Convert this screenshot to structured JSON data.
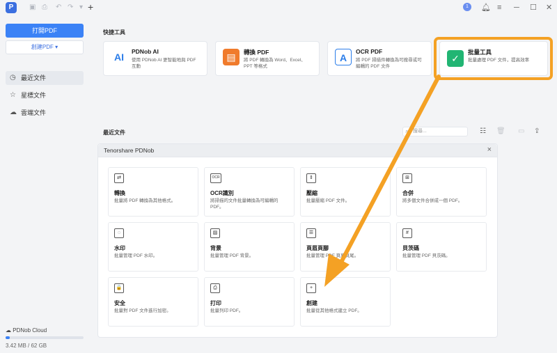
{
  "titlebar": {
    "logo": "P",
    "user_badge": "1",
    "icons": [
      "bell-icon",
      "menu-icon",
      "minimize-icon",
      "maximize-icon",
      "close-icon"
    ]
  },
  "sidebar": {
    "open_pdf": "打開PDF",
    "create_pdf": "創建PDF ▾",
    "nav": [
      {
        "label": "最近文件",
        "icon": "clock-icon"
      },
      {
        "label": "星標文件",
        "icon": "star-icon"
      },
      {
        "label": "雲端文件",
        "icon": "cloud-icon"
      }
    ],
    "cloud": {
      "label": "PDNob Cloud",
      "usage": "3.42 MB / 62 GB",
      "fraction": 0.05
    }
  },
  "quick_tools": {
    "heading": "快捷工具",
    "cards": [
      {
        "title": "PDNob AI",
        "desc": "使用 PDNob AI 更智能地與 PDF 互動",
        "icon_text": "AI",
        "icon": "ai-icon"
      },
      {
        "title": "轉換 PDF",
        "desc": "將 PDF 轉換為 Word、Excel、PPT 等格式",
        "icon_text": "▤",
        "icon": "convert-icon"
      },
      {
        "title": "OCR PDF",
        "desc": "將 PDF 掃描件轉換為可搜尋或可編輯的 PDF 文件",
        "icon_text": "A",
        "icon": "ocr-icon"
      },
      {
        "title": "批量工具",
        "desc": "批量處理 PDF 文件，提高效率",
        "icon_text": "✓",
        "icon": "batch-check-icon"
      }
    ]
  },
  "recent": {
    "heading": "最近文件",
    "search_placeholder": "搜尋..."
  },
  "panel": {
    "title": "Tenorshare PDNob",
    "cards": [
      {
        "title": "轉換",
        "desc": "批量將 PDF 轉換為其他格式。",
        "glyph": "⇄",
        "icon": "convert-icon"
      },
      {
        "title": "OCR識別",
        "desc": "將掃描的文件批量轉換為可編輯的 PDF。",
        "glyph": "OCR",
        "icon": "ocr-icon"
      },
      {
        "title": "壓縮",
        "desc": "批量壓縮 PDF 文件。",
        "glyph": "⇕",
        "icon": "compress-icon"
      },
      {
        "title": "合併",
        "desc": "將多個文件合併成一個 PDF。",
        "glyph": "⊞",
        "icon": "merge-icon"
      },
      {
        "title": "水印",
        "desc": "批量管理 PDF 水印。",
        "glyph": "◌",
        "icon": "watermark-icon"
      },
      {
        "title": "背景",
        "desc": "批量管理 PDF 背景。",
        "glyph": "▨",
        "icon": "background-icon"
      },
      {
        "title": "頁眉頁腳",
        "desc": "批量管理 PDF 頁眉頁尾。",
        "glyph": "☰",
        "icon": "header-footer-icon"
      },
      {
        "title": "貝茨碼",
        "desc": "批量管理 PDF 貝茨碼。",
        "glyph": "#",
        "icon": "bates-icon"
      },
      {
        "title": "安全",
        "desc": "批量對 PDF 文件進行加密。",
        "glyph": "🔒",
        "icon": "lock-icon"
      },
      {
        "title": "打印",
        "desc": "批量列印 PDF。",
        "glyph": "⎙",
        "icon": "print-icon"
      },
      {
        "title": "創建",
        "desc": "批量從其他格式建立 PDF。",
        "glyph": "+",
        "icon": "create-icon"
      }
    ]
  },
  "colors": {
    "accent": "#3b82f6",
    "highlight": "#f4a124"
  }
}
